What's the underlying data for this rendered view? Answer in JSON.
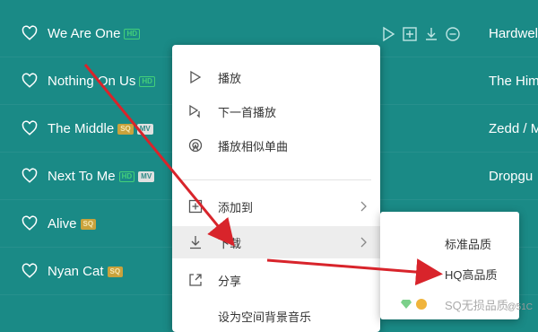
{
  "songs": [
    {
      "title": "We Are One",
      "badges": [
        "HD"
      ],
      "artist": "Hardwel"
    },
    {
      "title": "Nothing On Us",
      "badges": [
        "HD"
      ],
      "artist": "The Him"
    },
    {
      "title": "The Middle",
      "badges": [
        "SQ",
        "MV"
      ],
      "artist": "Zedd / M"
    },
    {
      "title": "Next To Me",
      "badges": [
        "HD",
        "MV"
      ],
      "artist": "Dropgu"
    },
    {
      "title": "Alive",
      "badges": [
        "SQ"
      ],
      "artist": ""
    },
    {
      "title": "Nyan Cat",
      "badges": [
        "SQ"
      ],
      "artist": ""
    }
  ],
  "row_actions": [
    "play-icon",
    "add-icon",
    "download-icon",
    "more-icon"
  ],
  "context_menu": {
    "items": [
      {
        "label": "播放",
        "icon": "play-icon"
      },
      {
        "label": "下一首播放",
        "icon": "play-next-icon"
      },
      {
        "label": "播放相似单曲",
        "icon": "radar-icon"
      },
      {
        "label": "添加到",
        "icon": "add-to-icon",
        "submenu": true
      },
      {
        "label": "下载",
        "icon": "download-icon",
        "submenu": true
      },
      {
        "label": "分享",
        "icon": "share-icon"
      },
      {
        "label": "设为空间背景音乐",
        "icon": "bgm-icon"
      }
    ]
  },
  "download_submenu": {
    "items": [
      {
        "label": "标准品质"
      },
      {
        "label": "HQ高品质"
      },
      {
        "label": "SQ无损品质"
      }
    ]
  },
  "watermark": "@51C",
  "colors": {
    "row_bg": "#1a8a86",
    "menu_bg": "#ffffff",
    "arrow": "#d8242b",
    "hd_badge": "#43d07a",
    "sq_badge": "#c9a23c"
  }
}
